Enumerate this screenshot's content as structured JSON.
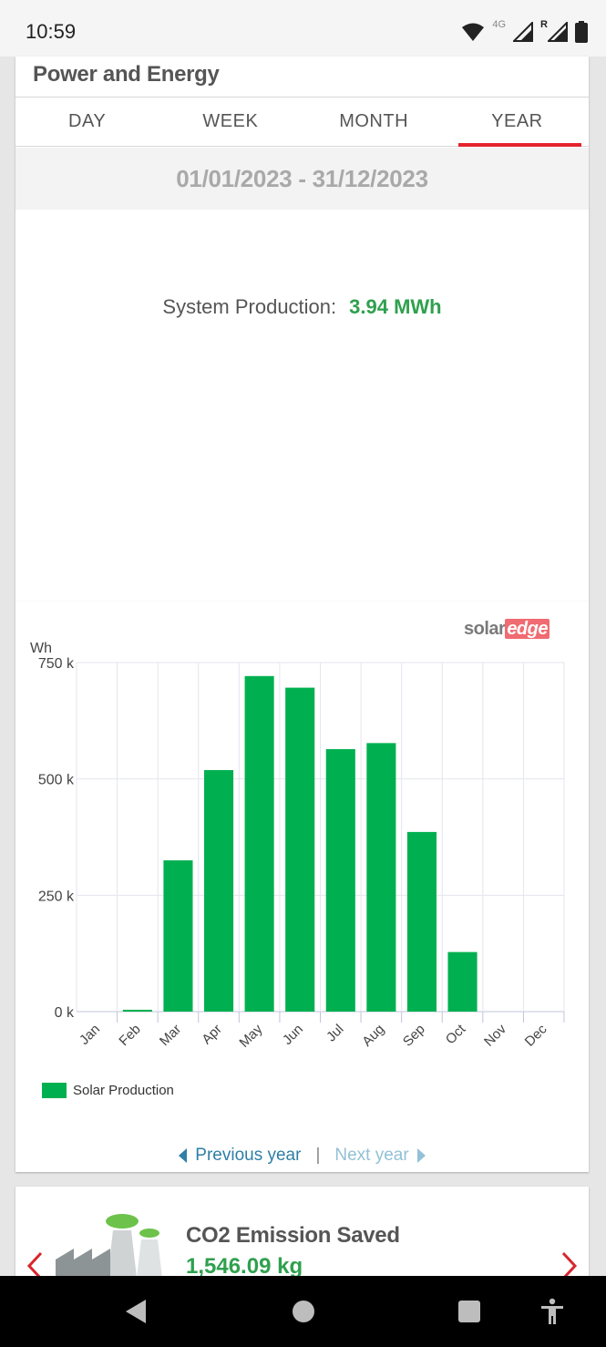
{
  "status_bar": {
    "time": "10:59",
    "network_label": "4G",
    "roaming_label": "R",
    "icons": [
      "wifi-icon",
      "signal-icon",
      "signal-roaming-icon",
      "battery-icon"
    ]
  },
  "card": {
    "title": "Power and Energy",
    "tabs": [
      {
        "label": "DAY",
        "active": false
      },
      {
        "label": "WEEK",
        "active": false
      },
      {
        "label": "MONTH",
        "active": false
      },
      {
        "label": "YEAR",
        "active": true
      }
    ],
    "date_range": "01/01/2023 - 31/12/2023",
    "production_label": "System Production:",
    "production_value": "3.94 MWh"
  },
  "logo": {
    "part1": "solar",
    "part2": "edge"
  },
  "chart_data": {
    "type": "bar",
    "ylabel": "Wh",
    "ylim": [
      0,
      750000
    ],
    "yticks": [
      {
        "value": 0,
        "label": "0 k"
      },
      {
        "value": 250000,
        "label": "250 k"
      },
      {
        "value": 500000,
        "label": "500 k"
      },
      {
        "value": 750000,
        "label": "750 k"
      }
    ],
    "categories": [
      "Jan",
      "Feb",
      "Mar",
      "Apr",
      "May",
      "Jun",
      "Jul",
      "Aug",
      "Sep",
      "Oct",
      "Nov",
      "Dec"
    ],
    "series": [
      {
        "name": "Solar Production",
        "color": "#00b050",
        "values": [
          0,
          4000,
          325000,
          519000,
          721000,
          696000,
          564000,
          577000,
          386000,
          128000,
          0,
          0
        ]
      }
    ],
    "grid": true,
    "legend": "bottom-left"
  },
  "pager": {
    "prev_label": "Previous year",
    "separator": "|",
    "next_label": "Next year"
  },
  "co2": {
    "title": "CO2 Emission Saved",
    "value": "1,546.09 kg"
  },
  "colors": {
    "accent": "#e3232a",
    "green": "#2fa04e",
    "bar": "#00b050",
    "link": "#2f7fa6"
  }
}
